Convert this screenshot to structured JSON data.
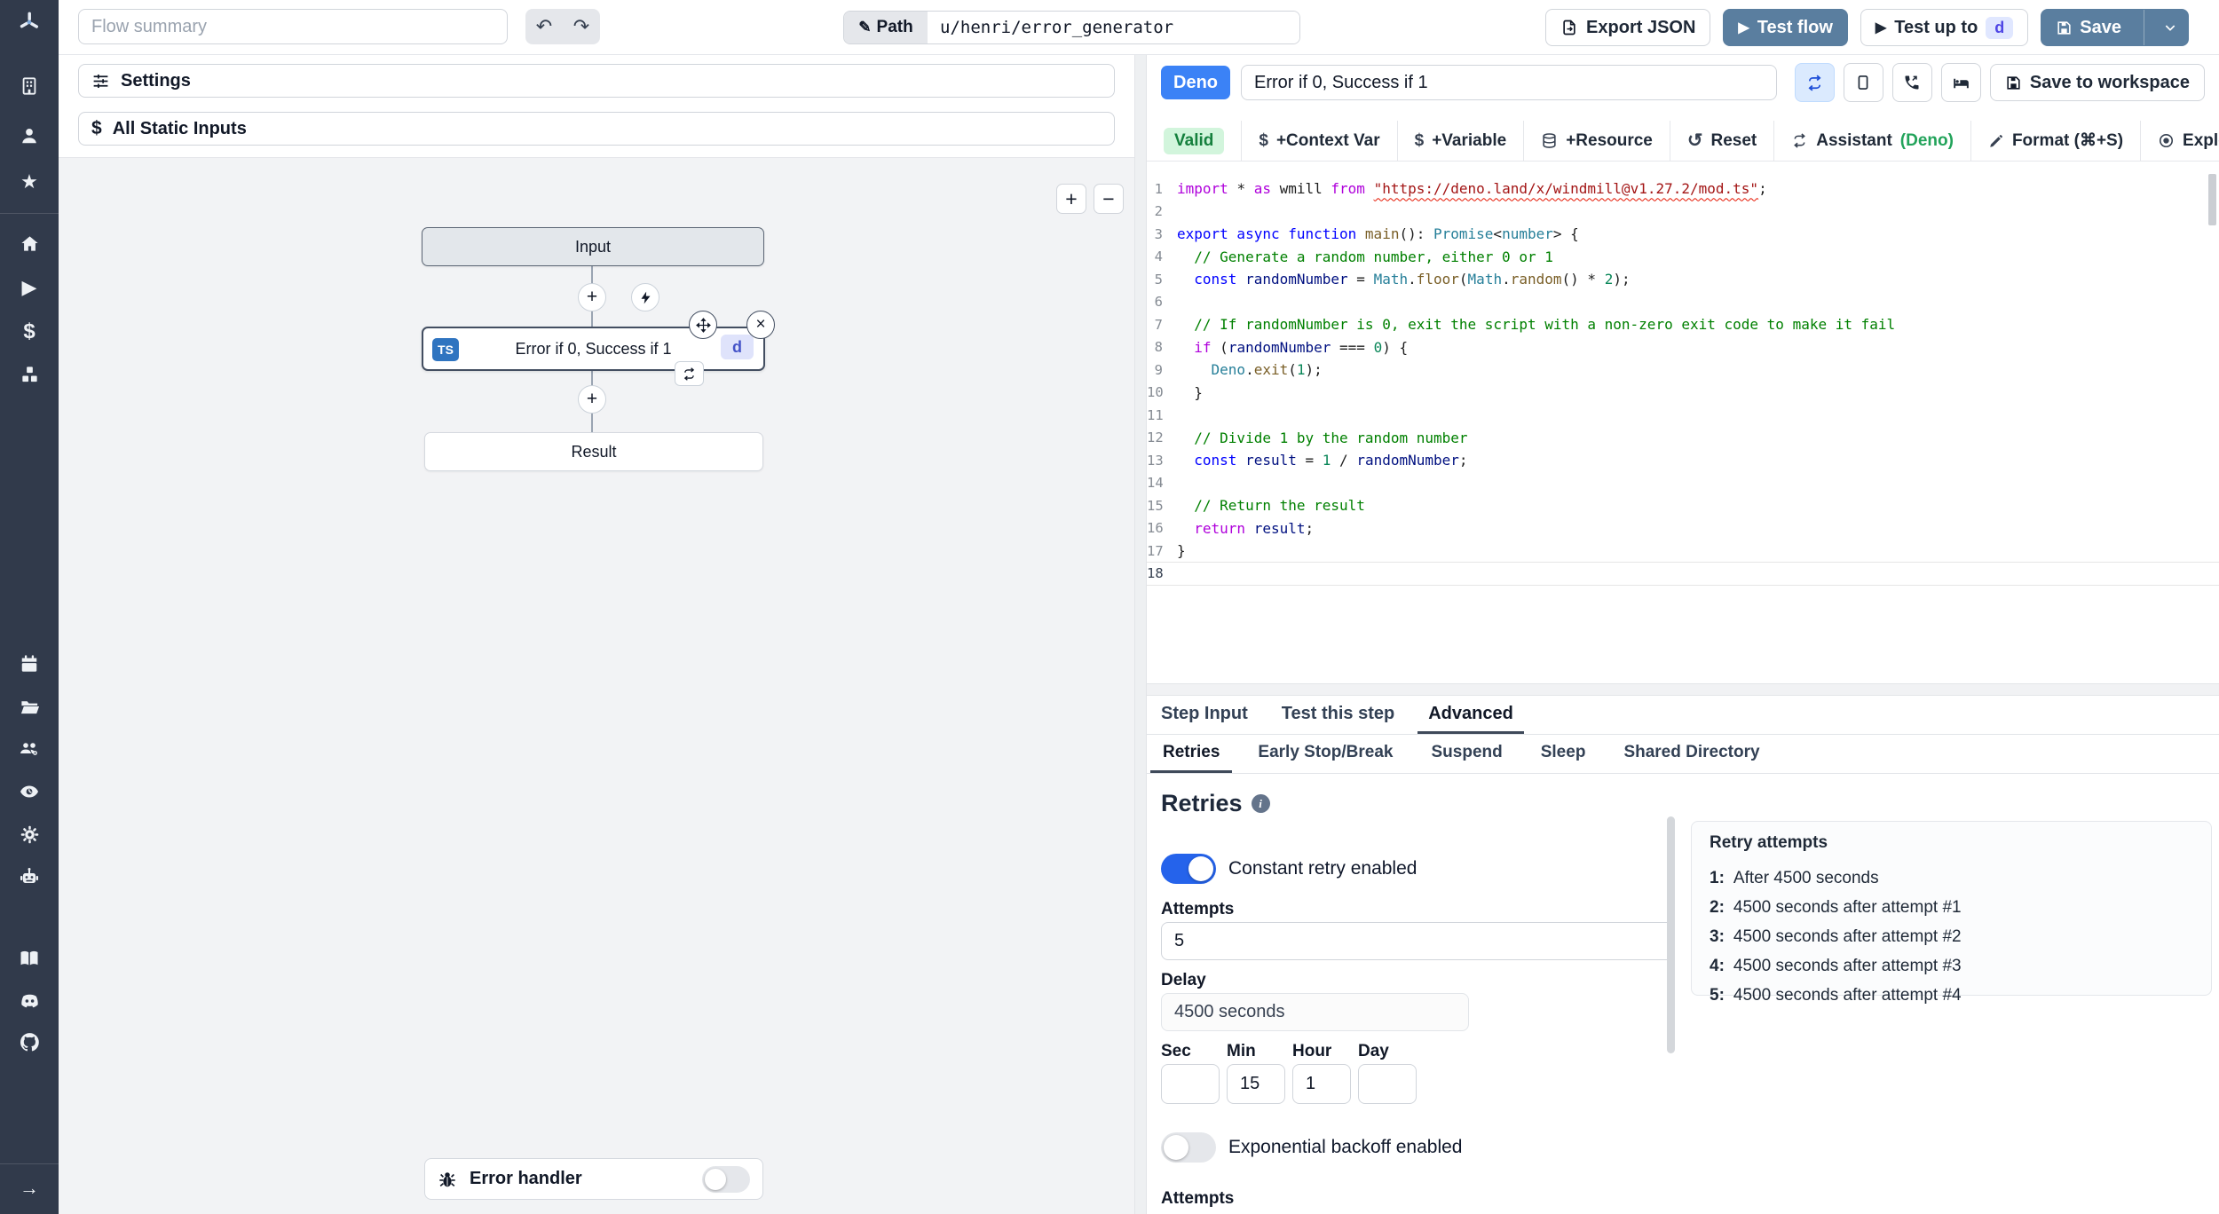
{
  "sidebar": {
    "icons": [
      "windmill-logo",
      "workspace",
      "user",
      "favorites",
      "home",
      "runs",
      "variables",
      "resources",
      "schedules",
      "folders",
      "groups",
      "audit-logs",
      "settings",
      "workers",
      "docs",
      "discord",
      "github",
      "expand"
    ]
  },
  "topbar": {
    "flow_summary_placeholder": "Flow summary",
    "path_label": "Path",
    "path_value": "u/henri/error_generator",
    "export_json": "Export JSON",
    "test_flow": "Test flow",
    "test_up_to": "Test up to",
    "test_up_to_badge": "d",
    "save": "Save"
  },
  "flow": {
    "settings": "Settings",
    "all_static_inputs": "All Static Inputs",
    "zoom_in": "+",
    "zoom_out": "−",
    "input_node": "Input",
    "step_lang_badge": "TS",
    "step_title": "Error if 0, Success if 1",
    "step_id_badge": "d",
    "result_node": "Result",
    "error_handler": "Error handler"
  },
  "editor": {
    "lang_badge": "Deno",
    "title": "Error if 0, Success if 1",
    "save_to_workspace": "Save to workspace",
    "toolbar": {
      "valid": "Valid",
      "context_var": "+Context Var",
      "variable": "+Variable",
      "resource": "+Resource",
      "reset": "Reset",
      "assistant_prefix": "Assistant ",
      "assistant_lang": "(Deno)",
      "format": "Format (⌘+S)",
      "explore": "Explore other s"
    },
    "code": {
      "current_line": 18,
      "lines": [
        [
          [
            "ctrl",
            "import "
          ],
          [
            "pln",
            "* "
          ],
          [
            "ctrl",
            "as "
          ],
          [
            "pln",
            "wmill "
          ],
          [
            "ctrl",
            "from "
          ],
          [
            "str sq",
            "\"https://deno.land/x/windmill@v1.27.2/mod.ts\""
          ],
          [
            "pln",
            ";"
          ]
        ],
        [],
        [
          [
            "kw",
            "export async function "
          ],
          [
            "fn",
            "main"
          ],
          [
            "pln",
            "(): "
          ],
          [
            "typ",
            "Promise"
          ],
          [
            "pln",
            "<"
          ],
          [
            "typ",
            "number"
          ],
          [
            "pln",
            "> {"
          ]
        ],
        [
          [
            "cmt",
            "  // Generate a random number, either 0 or 1"
          ]
        ],
        [
          [
            "pln",
            "  "
          ],
          [
            "kw",
            "const "
          ],
          [
            "vr",
            "randomNumber"
          ],
          [
            "pln",
            " = "
          ],
          [
            "typ",
            "Math"
          ],
          [
            "pln",
            "."
          ],
          [
            "fn",
            "floor"
          ],
          [
            "pln",
            "("
          ],
          [
            "typ",
            "Math"
          ],
          [
            "pln",
            "."
          ],
          [
            "fn",
            "random"
          ],
          [
            "pln",
            "() * "
          ],
          [
            "num",
            "2"
          ],
          [
            "pln",
            ");"
          ]
        ],
        [],
        [
          [
            "cmt",
            "  // If randomNumber is 0, exit the script with a non-zero exit code to make it fail"
          ]
        ],
        [
          [
            "pln",
            "  "
          ],
          [
            "ctrl",
            "if "
          ],
          [
            "pln",
            "("
          ],
          [
            "vr",
            "randomNumber"
          ],
          [
            "pln",
            " === "
          ],
          [
            "num",
            "0"
          ],
          [
            "pln",
            ") {"
          ]
        ],
        [
          [
            "pln",
            "    "
          ],
          [
            "typ",
            "Deno"
          ],
          [
            "pln",
            "."
          ],
          [
            "fn",
            "exit"
          ],
          [
            "pln",
            "("
          ],
          [
            "num",
            "1"
          ],
          [
            "pln",
            ");"
          ]
        ],
        [
          [
            "pln",
            "  }"
          ]
        ],
        [],
        [
          [
            "cmt",
            "  // Divide 1 by the random number"
          ]
        ],
        [
          [
            "pln",
            "  "
          ],
          [
            "kw",
            "const "
          ],
          [
            "vr",
            "result"
          ],
          [
            "pln",
            " = "
          ],
          [
            "num",
            "1"
          ],
          [
            "pln",
            " / "
          ],
          [
            "vr",
            "randomNumber"
          ],
          [
            "pln",
            ";"
          ]
        ],
        [],
        [
          [
            "cmt",
            "  // Return the result"
          ]
        ],
        [
          [
            "pln",
            "  "
          ],
          [
            "ctrl",
            "return "
          ],
          [
            "vr",
            "result"
          ],
          [
            "pln",
            ";"
          ]
        ],
        [
          [
            "pln",
            "}"
          ]
        ],
        []
      ]
    }
  },
  "tabs": [
    "Step Input",
    "Test this step",
    "Advanced"
  ],
  "subtabs": [
    "Retries",
    "Early Stop/Break",
    "Suspend",
    "Sleep",
    "Shared Directory"
  ],
  "retries": {
    "heading": "Retries",
    "constant_toggle_label": "Constant retry enabled",
    "attempts_label": "Attempts",
    "attempts_value": "5",
    "delay_label": "Delay",
    "delay_value": "4500 seconds",
    "time_fields": [
      {
        "label": "Sec",
        "value": ""
      },
      {
        "label": "Min",
        "value": "15"
      },
      {
        "label": "Hour",
        "value": "1"
      },
      {
        "label": "Day",
        "value": ""
      }
    ],
    "exponential_toggle_label": "Exponential backoff enabled",
    "cutoff_label": "Attempts",
    "preview": {
      "title": "Retry attempts",
      "items": [
        {
          "n": "1:",
          "text": "After 4500 seconds"
        },
        {
          "n": "2:",
          "text": "4500 seconds after attempt #1"
        },
        {
          "n": "3:",
          "text": "4500 seconds after attempt #2"
        },
        {
          "n": "4:",
          "text": "4500 seconds after attempt #3"
        },
        {
          "n": "5:",
          "text": "4500 seconds after attempt #4"
        }
      ]
    }
  },
  "colors": {
    "sidebar_bg": "#313a4b",
    "steel_blue": "#5a7e9f",
    "accent_blue": "#3b82f6",
    "toggle_on": "#2563eb",
    "valid_bg": "#d2f5dc",
    "valid_text": "#15803d",
    "indigo_badge_bg": "#e0e7ff",
    "indigo_badge_text": "#4f46e5",
    "ts_badge": "#2f74c0",
    "canvas_bg": "#f2f3f5"
  }
}
